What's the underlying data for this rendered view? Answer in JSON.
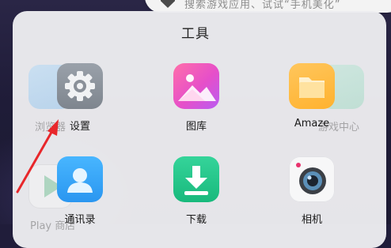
{
  "search": {
    "hint": "搜索游戏应用、试试“手机美化”"
  },
  "folder": {
    "title": "工具"
  },
  "background_apps": [
    {
      "label": "浏览器"
    },
    {
      "label": "游戏中心"
    },
    {
      "label": "Play 商店"
    }
  ],
  "apps": [
    {
      "label": "设置",
      "icon": "gear-icon"
    },
    {
      "label": "图库",
      "icon": "gallery-icon"
    },
    {
      "label": "Amaze",
      "icon": "folder-icon"
    },
    {
      "label": "通讯录",
      "icon": "contacts-icon"
    },
    {
      "label": "下载",
      "icon": "download-icon"
    },
    {
      "label": "相机",
      "icon": "camera-icon"
    }
  ],
  "colors": {
    "annotation_arrow": "#e8272b",
    "folder_bg": "#ececf0"
  }
}
